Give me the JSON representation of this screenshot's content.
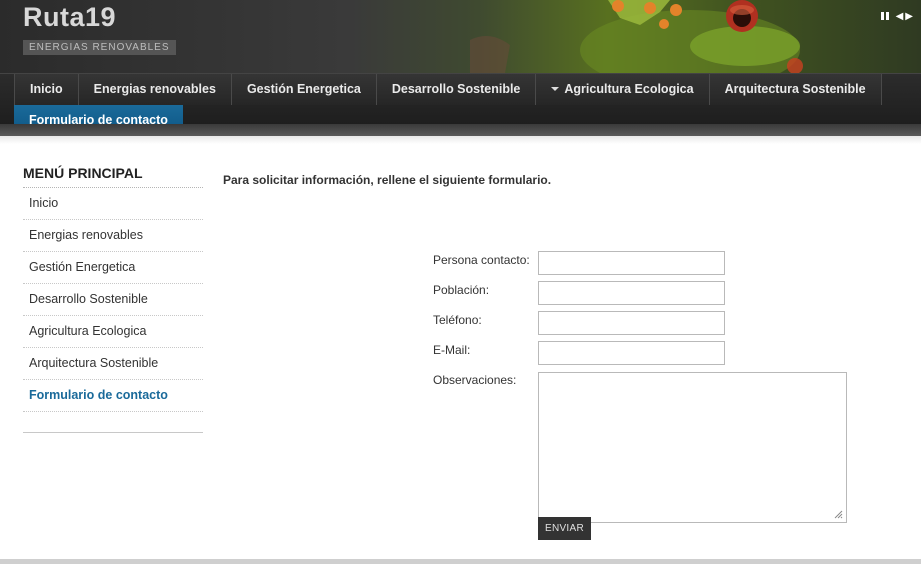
{
  "header": {
    "title": "Ruta19",
    "subtitle": "ENERGIAS RENOVABLES",
    "slider_controls": [
      "pause-icon",
      "prev-arrow-icon",
      "next-arrow-icon"
    ]
  },
  "nav": {
    "row1": [
      {
        "label": "Inicio"
      },
      {
        "label": "Energias renovables"
      },
      {
        "label": "Gestión Energetica"
      },
      {
        "label": "Desarrollo Sostenible"
      },
      {
        "label": "Agricultura Ecologica",
        "has_dropdown": true
      },
      {
        "label": "Arquitectura Sostenible"
      }
    ],
    "row2": [
      {
        "label": "Formulario de contacto",
        "active": true
      }
    ]
  },
  "sidebar": {
    "title": "MENÚ PRINCIPAL",
    "items": [
      {
        "label": "Inicio"
      },
      {
        "label": "Energias renovables"
      },
      {
        "label": "Gestión Energetica"
      },
      {
        "label": "Desarrollo Sostenible"
      },
      {
        "label": "Agricultura Ecologica"
      },
      {
        "label": "Arquitectura Sostenible"
      },
      {
        "label": "Formulario de contacto",
        "active": true
      }
    ]
  },
  "main": {
    "intro": "Para solicitar información, rellene el siguiente formulario.",
    "form": {
      "contact_label": "Persona contacto:",
      "contact_value": "",
      "city_label": "Población:",
      "city_value": "",
      "phone_label": "Teléfono:",
      "phone_value": "",
      "email_label": "E-Mail:",
      "email_value": "",
      "notes_label": "Observaciones:",
      "notes_value": "",
      "submit_label": "ENVIAR"
    }
  },
  "colors": {
    "accent": "#0d5583",
    "active_link": "#1a6a9a",
    "nav_bg": "#222222"
  }
}
